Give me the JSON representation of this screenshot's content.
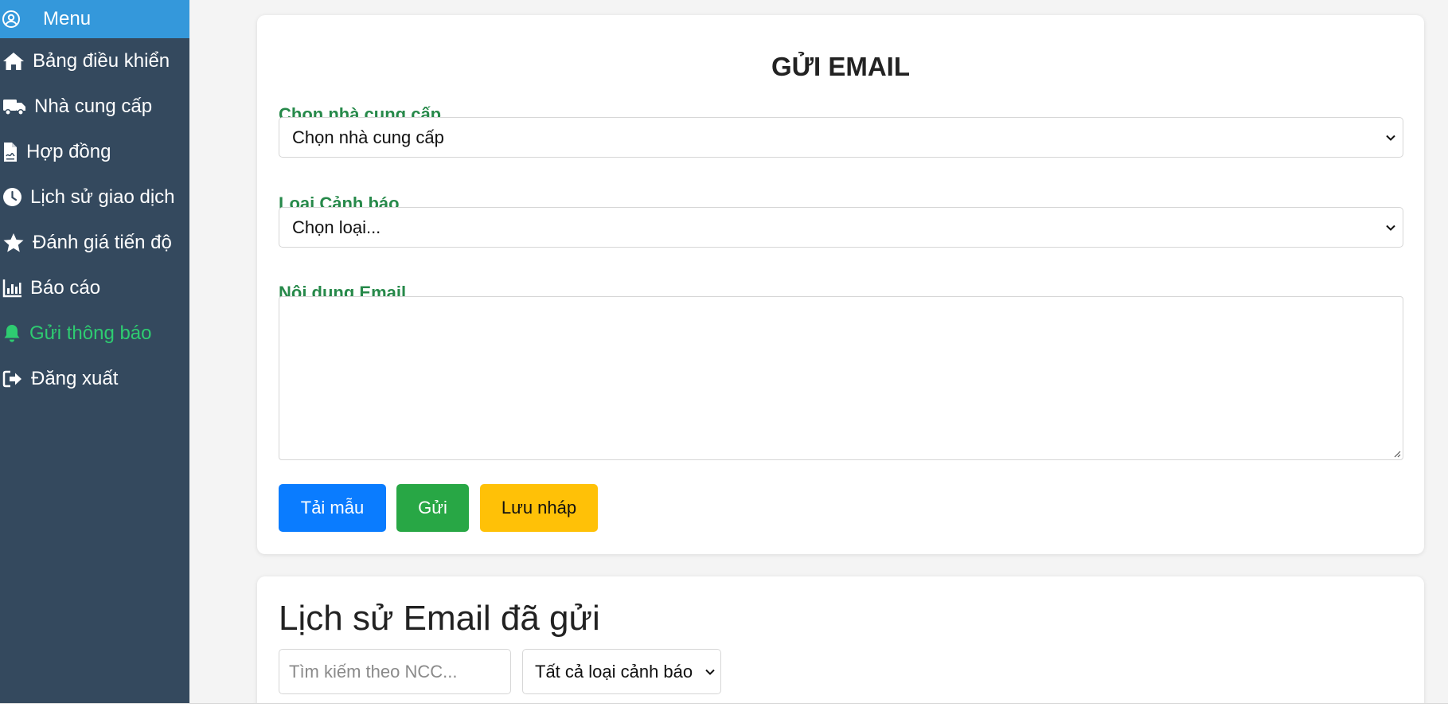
{
  "sidebar": {
    "header_label": "Menu",
    "items": [
      {
        "label": "Bảng điều khiển",
        "icon": "home-icon"
      },
      {
        "label": "Nhà cung cấp",
        "icon": "truck-icon"
      },
      {
        "label": "Hợp đồng",
        "icon": "contract-file-icon"
      },
      {
        "label": "Lịch sử giao dịch",
        "icon": "clock-icon"
      },
      {
        "label": "Đánh giá tiến độ",
        "icon": "star-icon"
      },
      {
        "label": "Báo cáo",
        "icon": "chart-bar-icon"
      },
      {
        "label": "Gửi thông báo",
        "icon": "bell-icon",
        "active": true
      },
      {
        "label": "Đăng xuất",
        "icon": "logout-icon"
      }
    ]
  },
  "email_form": {
    "title": "GỬI EMAIL",
    "supplier_label": "Chọn nhà cung cấp",
    "supplier_selected": "Chọn nhà cung cấp",
    "alert_type_label": "Loại Cảnh báo",
    "alert_type_selected": "Chọn loại...",
    "content_label": "Nội dung Email",
    "content_value": "",
    "buttons": {
      "load_template": "Tải mẫu",
      "send": "Gửi",
      "save_draft": "Lưu nháp"
    }
  },
  "history": {
    "title": "Lịch sử Email đã gửi",
    "search_placeholder": "Tìm kiếm theo NCC...",
    "filter_selected": "Tất cả loại cảnh báo"
  },
  "colors": {
    "sidebar_bg": "#34495e",
    "menu_header_bg": "#3498db",
    "active_item": "#2ecc71",
    "label_green": "#27894a",
    "btn_primary": "#0a7cff",
    "btn_success": "#28a745",
    "btn_warning": "#ffc107"
  }
}
